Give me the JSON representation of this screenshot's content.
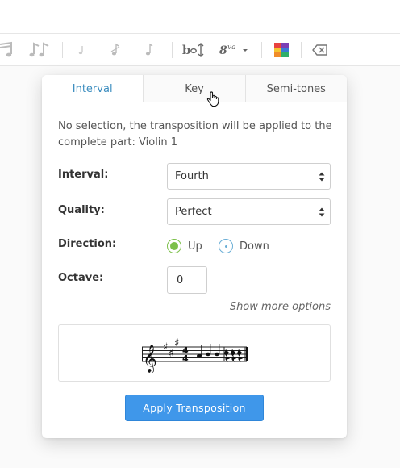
{
  "toolbar": {
    "icons": [
      "sixteenth-note-icon",
      "beamed-sixteenth-icon",
      "grace-note-icon",
      "acciaccatura-icon",
      "appoggiatura-icon",
      "transpose-icon",
      "ottava-icon",
      "color-icon",
      "delete-icon"
    ],
    "ottava_label": "8va"
  },
  "tabs": [
    {
      "label": "Interval",
      "active": true
    },
    {
      "label": "Key",
      "active": false
    },
    {
      "label": "Semi-tones",
      "active": false
    }
  ],
  "info_text": "No selection, the transposition will be applied to the complete part: Violin 1",
  "form": {
    "interval_label": "Interval:",
    "interval_value": "Fourth",
    "quality_label": "Quality:",
    "quality_value": "Perfect",
    "direction_label": "Direction:",
    "direction_up": "Up",
    "direction_down": "Down",
    "direction_selected": "Up",
    "octave_label": "Octave:",
    "octave_value": "0"
  },
  "show_more": "Show more options",
  "apply_label": "Apply Transposition",
  "colors": {
    "accent_blue": "#3c8dbf",
    "button_blue": "#3f97ea",
    "radio_green": "#7cc04a"
  }
}
